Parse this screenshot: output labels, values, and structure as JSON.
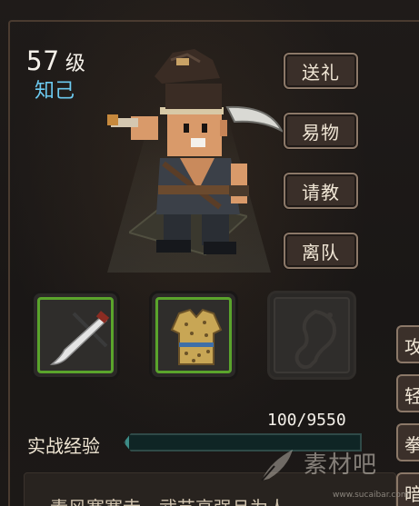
{
  "character": {
    "level_number": "57",
    "level_unit": "级",
    "relation": "知己"
  },
  "actions": [
    {
      "label": "送礼"
    },
    {
      "label": "易物"
    },
    {
      "label": "请教"
    },
    {
      "label": "离队"
    }
  ],
  "equipment": [
    {
      "name": "machete",
      "icon": "machete-icon",
      "filled": true
    },
    {
      "name": "armor",
      "icon": "leopard-armor-icon",
      "filled": true
    },
    {
      "name": "accessory",
      "icon": "empty-accessory-icon",
      "filled": false
    }
  ],
  "experience": {
    "label": "实战经验",
    "text": "100/9550",
    "current": 100,
    "max": 9550
  },
  "side_tabs": [
    {
      "label": "攻"
    },
    {
      "label": "轻"
    },
    {
      "label": "拳"
    },
    {
      "label": "暗"
    }
  ],
  "description": "素风寒寒寺，武艺高强且为人",
  "watermark": {
    "text": "素材吧",
    "url": "www.sucaibar.com"
  },
  "colors": {
    "relation": "#6ccaf0",
    "slot_border_filled": "#5aa42c",
    "exp_fill": "#3d8b86",
    "button_border": "#8b7868"
  }
}
